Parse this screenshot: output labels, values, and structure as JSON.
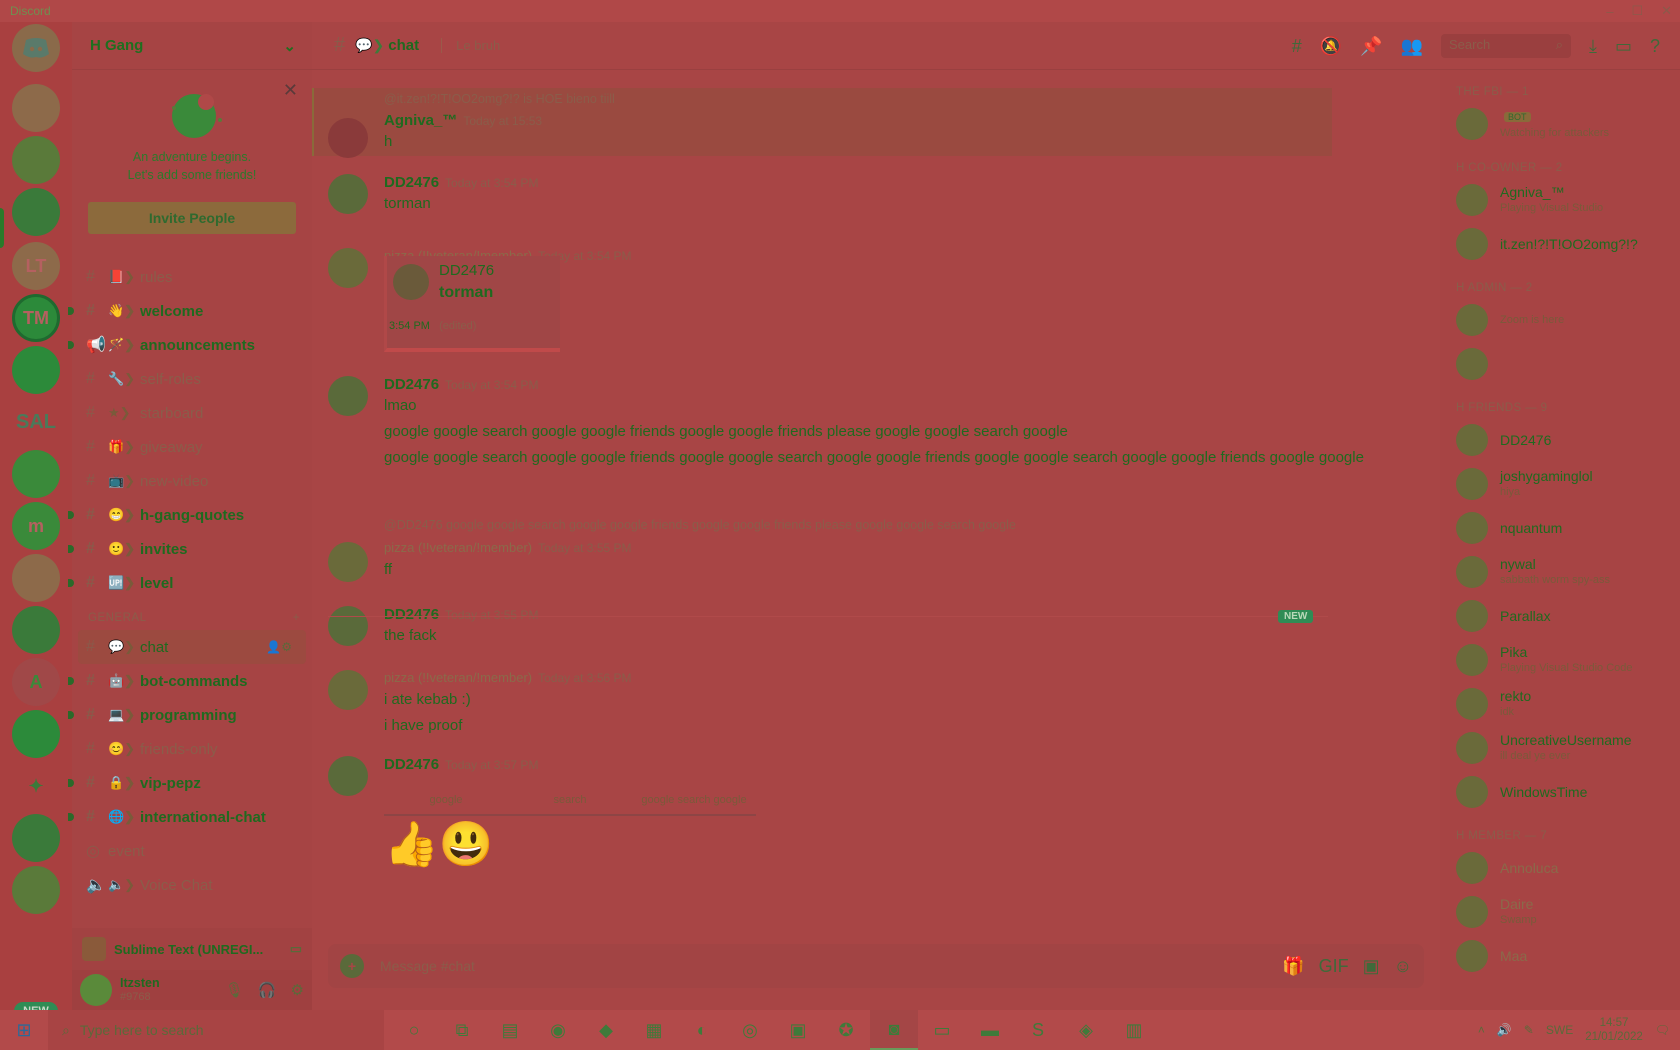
{
  "window": {
    "title": "Discord",
    "controls": [
      "–",
      "☐",
      "✕"
    ]
  },
  "servers": {
    "items": [
      {
        "label": "",
        "top": 0
      },
      {
        "label": ""
      },
      {
        "label": ""
      },
      {
        "label": "LT"
      },
      {
        "label": "TM"
      },
      {
        "label": ""
      },
      {
        "label": "SAL"
      },
      {
        "label": ""
      },
      {
        "label": "m"
      },
      {
        "label": ""
      },
      {
        "label": ""
      },
      {
        "label": "A"
      },
      {
        "label": ""
      },
      {
        "label": ""
      },
      {
        "label": ""
      },
      {
        "label": ""
      }
    ],
    "new_badge": "NEW"
  },
  "guild": {
    "name": "H Gang"
  },
  "invite_card": {
    "line1": "An adventure begins.",
    "line2": "Let's add some friends!",
    "button": "Invite People"
  },
  "channels_top": [
    {
      "name": "rules",
      "style": "muted"
    },
    {
      "name": "welcome",
      "style": "bold"
    },
    {
      "name": "announcements",
      "style": "bold"
    },
    {
      "name": "self-roles",
      "style": "muted"
    },
    {
      "name": "starboard",
      "style": "muted"
    },
    {
      "name": "giveaway",
      "style": "muted"
    },
    {
      "name": "new-video",
      "style": "muted"
    },
    {
      "name": "h-gang-quotes",
      "style": "bold"
    },
    {
      "name": "invites",
      "style": "bold"
    },
    {
      "name": "level",
      "style": "bold"
    }
  ],
  "category_general": "GENERAL",
  "channels_general": [
    {
      "name": "chat",
      "style": "active"
    },
    {
      "name": "bot-commands",
      "style": "bold"
    },
    {
      "name": "programming",
      "style": "bold"
    },
    {
      "name": "friends-only",
      "style": "muted"
    },
    {
      "name": "vip-pepz",
      "style": "bold"
    },
    {
      "name": "international-chat",
      "style": "bold"
    },
    {
      "name": "event",
      "style": "muted"
    },
    {
      "name": "Voice Chat",
      "style": "muted"
    }
  ],
  "activity": {
    "text": "Sublime Text (UNREGI..."
  },
  "user": {
    "name": "Itzsten",
    "tag": "#9768"
  },
  "header": {
    "channel": "chat",
    "topic": "Le bruh",
    "search_placeholder": "Search"
  },
  "messages": {
    "m0_reply": "@it.zen!?!T!OO2omg?!? is HOE bieno tiill",
    "m0_author": "Agniva_™",
    "m0_time": "Today at 15:53",
    "m0_body": "h",
    "m1_author": "DD2476",
    "m1_time": "Today at 3:54 PM",
    "m1_body": "torman",
    "m2_author": "pizza (!!veteran/!member)",
    "m2_time": "Today at 3:54 PM",
    "m2_embed_author": "DD2476",
    "m2_embed_text": "torman",
    "m2_embed_time": "3:54 PM",
    "m2_embed_foot": "(edited)",
    "m3_author": "DD2476",
    "m3_time": "Today at 3:54 PM",
    "m3_body1": "lmao",
    "m3_body2": "google google search google google friends google google friends please google google search google",
    "m3_body3": "google google search google google friends google google search google google friends google google search google google friends google google",
    "m4_reply": "@DD2476 google google search google google friends google google friends please google google search google",
    "m4_author": "pizza (!!veteran/!member)",
    "m4_time": "Today at 3:55 PM",
    "m4_body": "ff",
    "m5_author": "DD2476",
    "m5_time": "Today at 3:55 PM",
    "m5_body": "the fack",
    "new_tag": "NEW",
    "m6_author": "pizza (!!veteran/!member)",
    "m6_time": "Today at 3:56 PM",
    "m6_body1": "i ate kebab :)",
    "m6_body2": "i have proof",
    "m7_author": "DD2476",
    "m7_time": "Today at 3:57 PM",
    "m7_buttons": [
      "google",
      "search",
      "google search google"
    ],
    "m7_emoji": "👍😃"
  },
  "composer": {
    "placeholder": "Message #chat"
  },
  "members": {
    "role_fbi": "THE FBI — 1",
    "fbi": [
      {
        "name": "",
        "status": "Watching for attackers",
        "bot": "BOT"
      }
    ],
    "role_coowner": "H CO-OWNER — 2",
    "coowner": [
      {
        "name": "Agniva_™",
        "status": "Playing Visual Studio"
      },
      {
        "name": "it.zen!?!T!OO2omg?!?",
        "status": ""
      }
    ],
    "role_admin": "H ADMIN — 2",
    "admin": [
      {
        "name": "",
        "status": "Zoom is here"
      },
      {
        "name": "",
        "status": ""
      }
    ],
    "role_friends": "H FRIENDS — 9",
    "friends": [
      {
        "name": "DD2476",
        "status": ""
      },
      {
        "name": "joshygaminglol",
        "status": "hiya"
      },
      {
        "name": "nquantum",
        "status": ""
      },
      {
        "name": "nywal",
        "status": "sabbath worm spy-ass"
      },
      {
        "name": "Parallax",
        "status": ""
      },
      {
        "name": "Pika",
        "status": "Playing Visual Studio Code"
      },
      {
        "name": "rekto",
        "status": "idk"
      },
      {
        "name": "UncreativeUsername",
        "status": "ill deal ye ever"
      },
      {
        "name": "WindowsTime",
        "status": ""
      }
    ],
    "role_member": "H MEMBER — 7",
    "member": [
      {
        "name": "Annoluca",
        "status": ""
      },
      {
        "name": "Daire",
        "status": "Swamp"
      },
      {
        "name": "Maa",
        "status": ""
      }
    ]
  },
  "taskbar": {
    "search": "Type here to search",
    "lang": "SWE",
    "time": "14:57",
    "date": "21/01/2022"
  }
}
